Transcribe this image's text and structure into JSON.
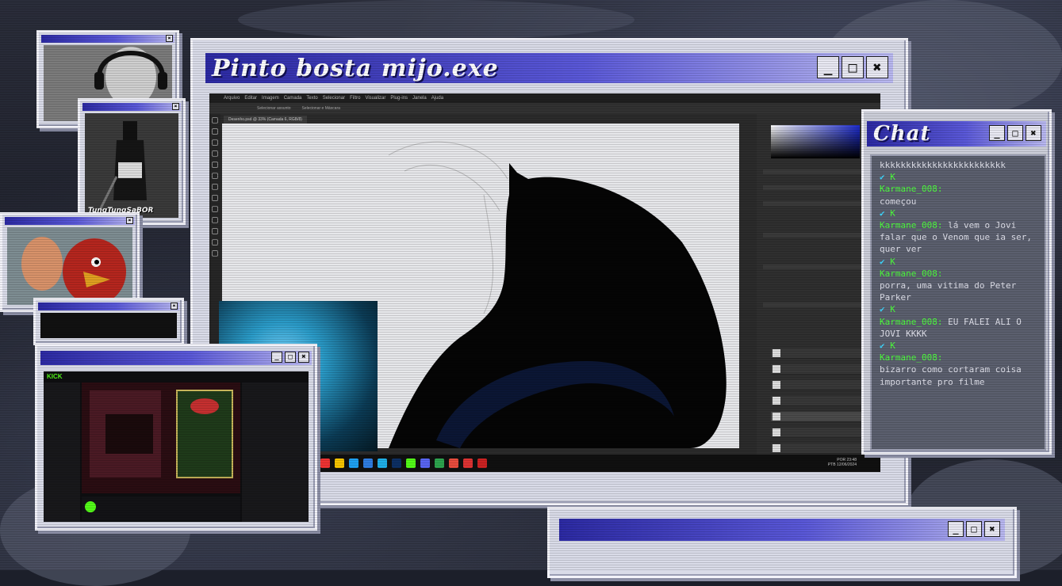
{
  "main_window": {
    "title": "Pinto bosta mijo.exe",
    "controls": {
      "minimize": "_",
      "maximize": "□",
      "close": "✖"
    }
  },
  "photoshop": {
    "menu": [
      "Arquivo",
      "Editar",
      "Imagem",
      "Camada",
      "Texto",
      "Selecionar",
      "Filtro",
      "Visualizar",
      "Plug-ins",
      "Janela",
      "Ajuda"
    ],
    "options": [
      "Selecionar assunto",
      "Selecionar e Máscara"
    ],
    "document_tab": "Desenho.psd @ 33% (Camada 6, RGB/8)",
    "layers": [
      "Camada 6",
      "Camada 5",
      "Camada 4",
      "Camada 3",
      "Camada 2",
      "Camada 1",
      "Fundo"
    ],
    "clock": {
      "time": "23:48",
      "date": "12/06/2024",
      "lang": "POR",
      "region": "PTB"
    }
  },
  "chat": {
    "title": "Chat",
    "messages": [
      {
        "user": "",
        "text": "kkkkkkkkkkkkkkkkkkkkkkkk"
      },
      {
        "user": "Karmane_008:",
        "text": "começou"
      },
      {
        "user": "Karmane_008:",
        "text": "lá vem o Jovi falar que o Venom que ia ser, quer ver"
      },
      {
        "user": "Karmane_008:",
        "text": "porra, uma vitima do Peter Parker"
      },
      {
        "user": "Karmane_008:",
        "text": "EU FALEI ALI O JOVI KKKK"
      },
      {
        "user": "Karmane_008:",
        "text": "bizarro como cortaram coisa importante pro filme"
      }
    ],
    "badge": "K"
  },
  "cams": {
    "bottle_caption": "TungTungSaBOR",
    "close": "✖"
  },
  "web_window": {
    "close": "✖",
    "logo": "KICK"
  },
  "colors": {
    "titlebar_start": "#2c2aa3",
    "titlebar_end": "#b9b8f0",
    "chat_user": "#4dff3d",
    "chat_bg": "#5b5f6e"
  }
}
